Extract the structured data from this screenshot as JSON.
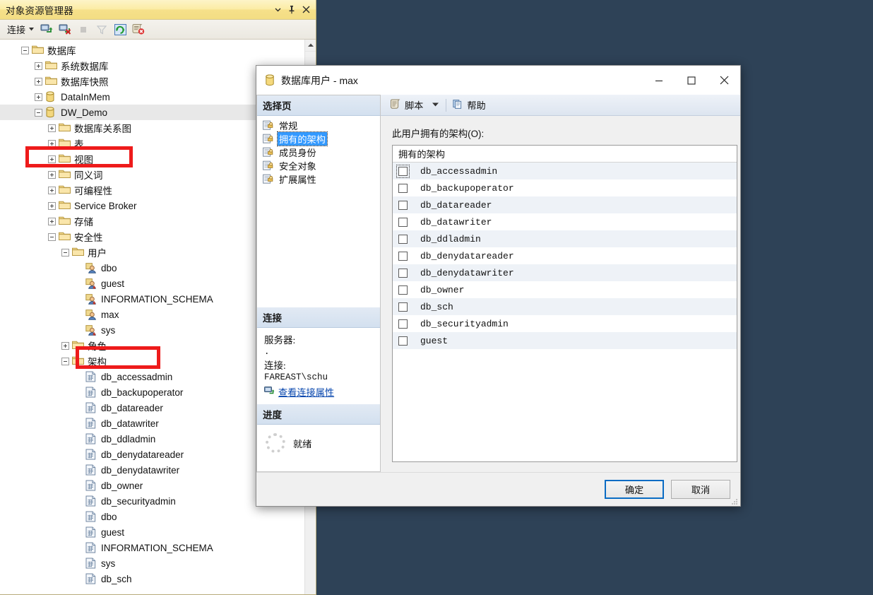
{
  "object_explorer": {
    "title": "对象资源管理器",
    "title_buttons": [
      {
        "name": "dropdown-icon",
        "glyph": "▾"
      },
      {
        "name": "pin-icon",
        "glyph": "⚲"
      },
      {
        "name": "close-icon",
        "glyph": "✕"
      }
    ],
    "toolbar": {
      "connect_label": "连接",
      "connect_caret": "▾",
      "buttons": [
        {
          "name": "connect-icon"
        },
        {
          "name": "disconnect-icon"
        },
        {
          "name": "stop-icon"
        },
        {
          "name": "filter-icon"
        },
        {
          "name": "refresh-icon"
        },
        {
          "name": "remove-connection-icon"
        }
      ]
    },
    "scrollbar": {
      "up_arrow": "⌃",
      "down_arrow": "⌄"
    },
    "tree": [
      {
        "label": "数据库",
        "indent": 0,
        "state": "expanded",
        "icon": "folder"
      },
      {
        "label": "系统数据库",
        "indent": 1,
        "state": "collapsed",
        "icon": "folder"
      },
      {
        "label": "数据库快照",
        "indent": 1,
        "state": "collapsed",
        "icon": "folder"
      },
      {
        "label": "DataInMem",
        "indent": 1,
        "state": "collapsed",
        "icon": "database"
      },
      {
        "label": "DW_Demo",
        "indent": 1,
        "state": "expanded",
        "icon": "database",
        "selected": true
      },
      {
        "label": "数据库关系图",
        "indent": 2,
        "state": "collapsed",
        "icon": "folder"
      },
      {
        "label": "表",
        "indent": 2,
        "state": "collapsed",
        "icon": "folder"
      },
      {
        "label": "视图",
        "indent": 2,
        "state": "collapsed",
        "icon": "folder"
      },
      {
        "label": "同义词",
        "indent": 2,
        "state": "collapsed",
        "icon": "folder"
      },
      {
        "label": "可编程性",
        "indent": 2,
        "state": "collapsed",
        "icon": "folder"
      },
      {
        "label": "Service Broker",
        "indent": 2,
        "state": "collapsed",
        "icon": "folder"
      },
      {
        "label": "存储",
        "indent": 2,
        "state": "collapsed",
        "icon": "folder"
      },
      {
        "label": "安全性",
        "indent": 2,
        "state": "expanded",
        "icon": "folder"
      },
      {
        "label": "用户",
        "indent": 3,
        "state": "expanded",
        "icon": "folder"
      },
      {
        "label": "dbo",
        "indent": 4,
        "state": "leaf",
        "icon": "user"
      },
      {
        "label": "guest",
        "indent": 4,
        "state": "leaf",
        "icon": "user-disabled"
      },
      {
        "label": "INFORMATION_SCHEMA",
        "indent": 4,
        "state": "leaf",
        "icon": "user-disabled"
      },
      {
        "label": "max",
        "indent": 4,
        "state": "leaf",
        "icon": "user"
      },
      {
        "label": "sys",
        "indent": 4,
        "state": "leaf",
        "icon": "user-disabled"
      },
      {
        "label": "角色",
        "indent": 3,
        "state": "collapsed",
        "icon": "folder"
      },
      {
        "label": "架构",
        "indent": 3,
        "state": "expanded",
        "icon": "folder"
      },
      {
        "label": "db_accessadmin",
        "indent": 4,
        "state": "leaf",
        "icon": "schema"
      },
      {
        "label": "db_backupoperator",
        "indent": 4,
        "state": "leaf",
        "icon": "schema"
      },
      {
        "label": "db_datareader",
        "indent": 4,
        "state": "leaf",
        "icon": "schema"
      },
      {
        "label": "db_datawriter",
        "indent": 4,
        "state": "leaf",
        "icon": "schema"
      },
      {
        "label": "db_ddladmin",
        "indent": 4,
        "state": "leaf",
        "icon": "schema"
      },
      {
        "label": "db_denydatareader",
        "indent": 4,
        "state": "leaf",
        "icon": "schema"
      },
      {
        "label": "db_denydatawriter",
        "indent": 4,
        "state": "leaf",
        "icon": "schema"
      },
      {
        "label": "db_owner",
        "indent": 4,
        "state": "leaf",
        "icon": "schema"
      },
      {
        "label": "db_securityadmin",
        "indent": 4,
        "state": "leaf",
        "icon": "schema"
      },
      {
        "label": "dbo",
        "indent": 4,
        "state": "leaf",
        "icon": "schema"
      },
      {
        "label": "guest",
        "indent": 4,
        "state": "leaf",
        "icon": "schema"
      },
      {
        "label": "INFORMATION_SCHEMA",
        "indent": 4,
        "state": "leaf",
        "icon": "schema"
      },
      {
        "label": "sys",
        "indent": 4,
        "state": "leaf",
        "icon": "schema"
      },
      {
        "label": "db_sch",
        "indent": 4,
        "state": "leaf",
        "icon": "schema"
      }
    ],
    "annotations": [
      {
        "name": "annotation-dw-demo",
        "target": "DW_Demo"
      },
      {
        "name": "annotation-max-user",
        "target": "max"
      }
    ]
  },
  "dialog": {
    "title": "数据库用户 - max",
    "window_buttons": [
      {
        "name": "minimize-button",
        "glyph": "—"
      },
      {
        "name": "maximize-button",
        "glyph": "❐"
      },
      {
        "name": "close-button",
        "glyph": "✕"
      }
    ],
    "select_page": {
      "header": "选择页",
      "items": [
        {
          "label": "常规"
        },
        {
          "label": "拥有的架构",
          "active": true
        },
        {
          "label": "成员身份"
        },
        {
          "label": "安全对象"
        },
        {
          "label": "扩展属性"
        }
      ]
    },
    "connection": {
      "header": "连接",
      "server_label": "服务器:",
      "server_value": ".",
      "connection_label": "连接:",
      "connection_value": "FAREAST\\schu",
      "view_properties_link": "查看连接属性"
    },
    "progress": {
      "header": "进度",
      "status": "就绪"
    },
    "script_toolbar": {
      "script_label": "脚本",
      "script_caret": "▾",
      "help_label": "帮助"
    },
    "owned_schemas": {
      "field_label": "此用户拥有的架构(O):",
      "column_header": "拥有的架构",
      "rows": [
        {
          "label": "db_accessadmin",
          "checked": false,
          "focused": true
        },
        {
          "label": "db_backupoperator",
          "checked": false
        },
        {
          "label": "db_datareader",
          "checked": false
        },
        {
          "label": "db_datawriter",
          "checked": false
        },
        {
          "label": "db_ddladmin",
          "checked": false
        },
        {
          "label": "db_denydatareader",
          "checked": false
        },
        {
          "label": "db_denydatawriter",
          "checked": false
        },
        {
          "label": "db_owner",
          "checked": false
        },
        {
          "label": "db_sch",
          "checked": false
        },
        {
          "label": "db_securityadmin",
          "checked": false
        },
        {
          "label": "guest",
          "checked": false
        }
      ]
    },
    "footer": {
      "ok_label": "确定",
      "cancel_label": "取消"
    }
  },
  "colors": {
    "desktop": "#2e4257",
    "annotation_red": "#ee1b1b",
    "selection_blue": "#3399ff",
    "default_button_border": "#0a6cc4",
    "panel_title_gradient_start": "#fdf4c8",
    "panel_title_gradient_end": "#f3dd83"
  }
}
